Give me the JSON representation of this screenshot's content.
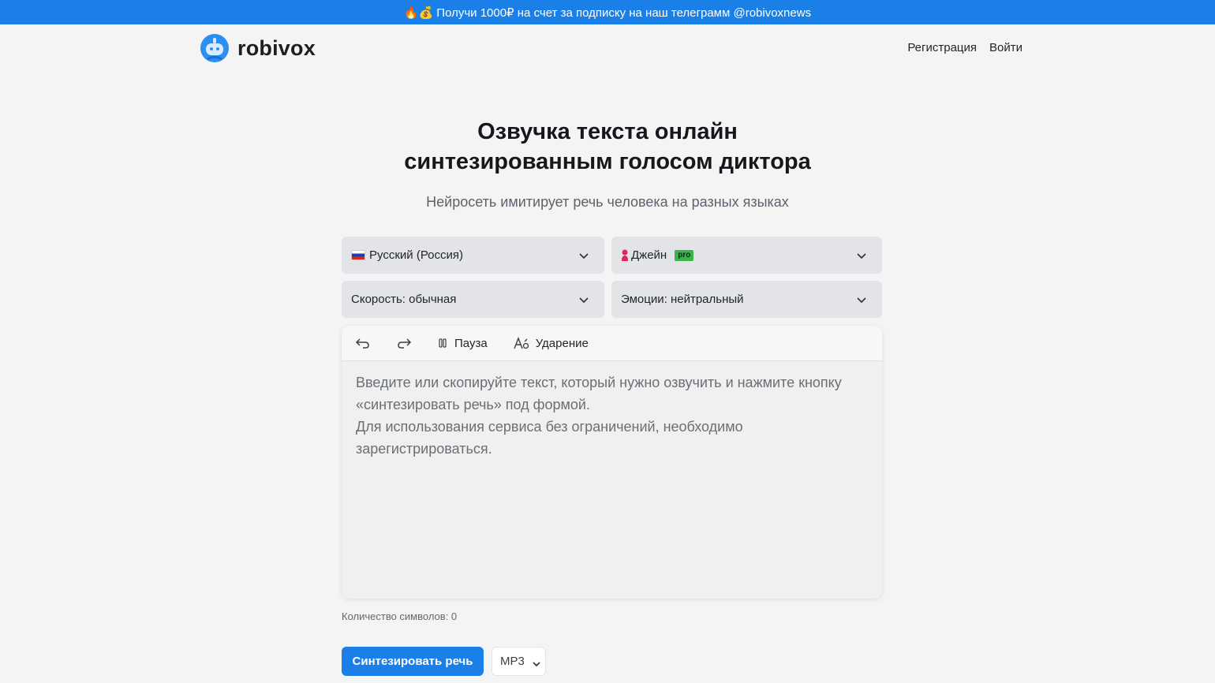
{
  "promo": {
    "emoji": "🔥💰",
    "text": "Получи 1000₽ на счет за подписку на наш телеграмм @robivoxnews"
  },
  "header": {
    "logo_text": "robivox",
    "nav": {
      "register": "Регистрация",
      "login": "Войти"
    }
  },
  "hero": {
    "title_line1": "Озвучка текста онлайн",
    "title_line2": "синтезированным голосом диктора",
    "subtitle": "Нейросеть имитирует речь человека на разных языках"
  },
  "controls": {
    "language": "Русский (Россия)",
    "voice": "Джейн",
    "voice_badge": "pro",
    "speed": "Скорость: обычная",
    "emotion": "Эмоции: нейтральный"
  },
  "toolbar": {
    "pause_label": "Пауза",
    "stress_label": "Ударение"
  },
  "editor": {
    "placeholder": "Введите или скопируйте текст, который нужно озвучить и нажмите кнопку «синтезировать речь» под формой.\nДля использования сервиса без ограничений, необходимо зарегистрироваться."
  },
  "counter": {
    "label": "Количество символов: 0"
  },
  "actions": {
    "synthesize_label": "Синтезировать речь",
    "format_value": "MP3"
  },
  "colors": {
    "accent": "#1a7fe6",
    "pro_badge": "#3cb34a"
  }
}
